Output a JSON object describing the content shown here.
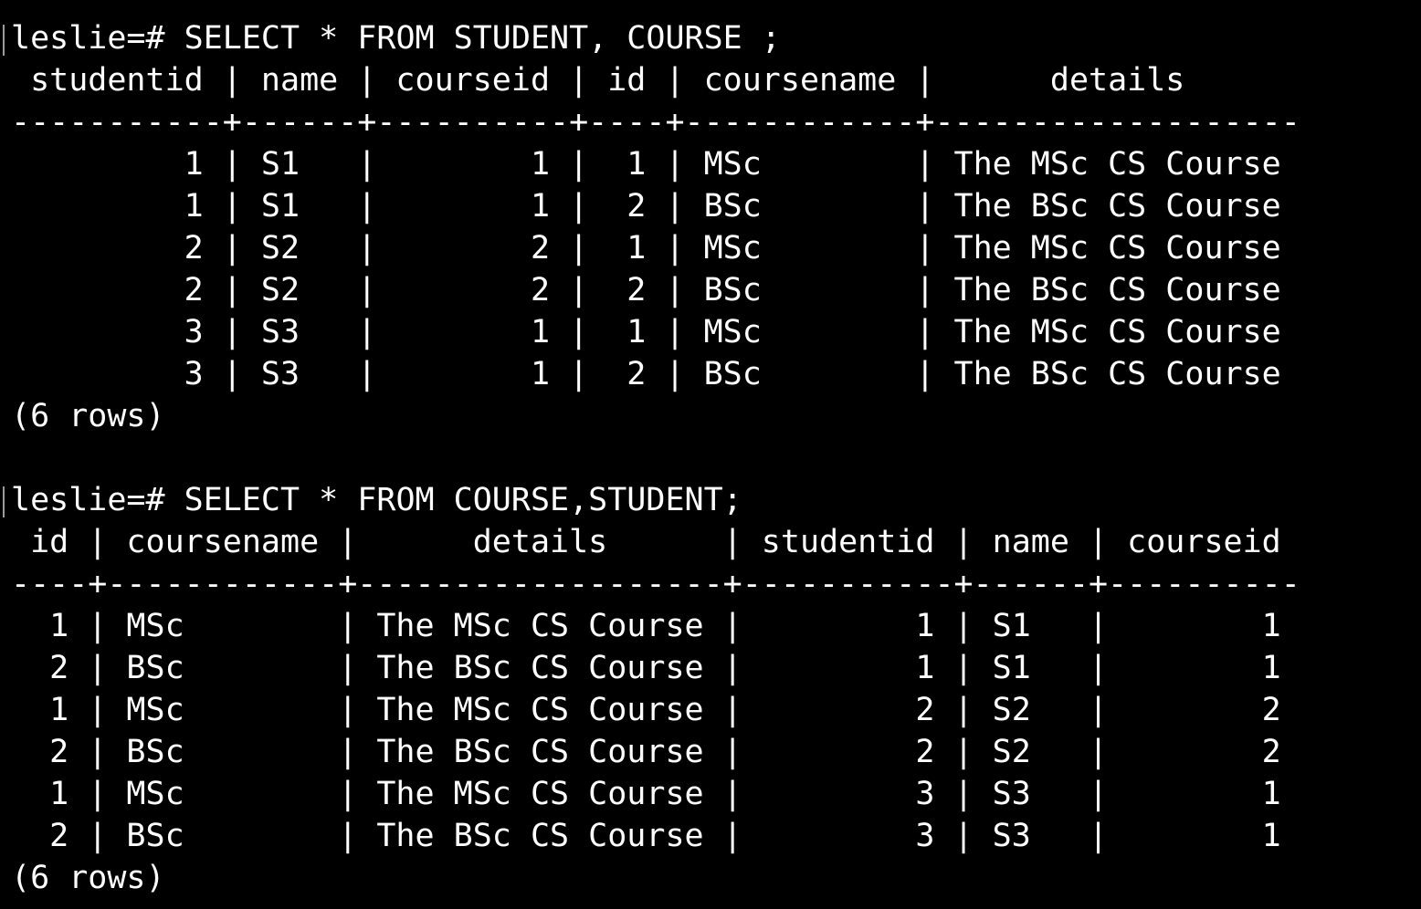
{
  "theme": {
    "background": "#000000",
    "foreground": "#ffffff"
  },
  "session": {
    "blocks": [
      {
        "prompt": "leslie=#",
        "command": " SELECT * FROM STUDENT, COURSE ;",
        "output": [
          " studentid | name | courseid | id | coursename |      details",
          "-----------+------+----------+----+------------+-------------------",
          "         1 | S1   |        1 |  1 | MSc        | The MSc CS Course",
          "         1 | S1   |        1 |  2 | BSc        | The BSc CS Course",
          "         2 | S2   |        2 |  1 | MSc        | The MSc CS Course",
          "         2 | S2   |        2 |  2 | BSc        | The BSc CS Course",
          "         3 | S3   |        1 |  1 | MSc        | The MSc CS Course",
          "         3 | S3   |        1 |  2 | BSc        | The BSc CS Course",
          "(6 rows)"
        ]
      },
      {
        "prompt": "leslie=#",
        "command": " SELECT * FROM COURSE,STUDENT;",
        "output": [
          " id | coursename |      details      | studentid | name | courseid",
          "----+------------+-------------------+-----------+------+----------",
          "  1 | MSc        | The MSc CS Course |         1 | S1   |        1",
          "  2 | BSc        | The BSc CS Course |         1 | S1   |        1",
          "  1 | MSc        | The MSc CS Course |         2 | S2   |        2",
          "  2 | BSc        | The BSc CS Course |         2 | S2   |        2",
          "  1 | MSc        | The MSc CS Course |         3 | S3   |        1",
          "  2 | BSc        | The BSc CS Course |         3 | S3   |        1",
          "(6 rows)"
        ]
      }
    ]
  }
}
